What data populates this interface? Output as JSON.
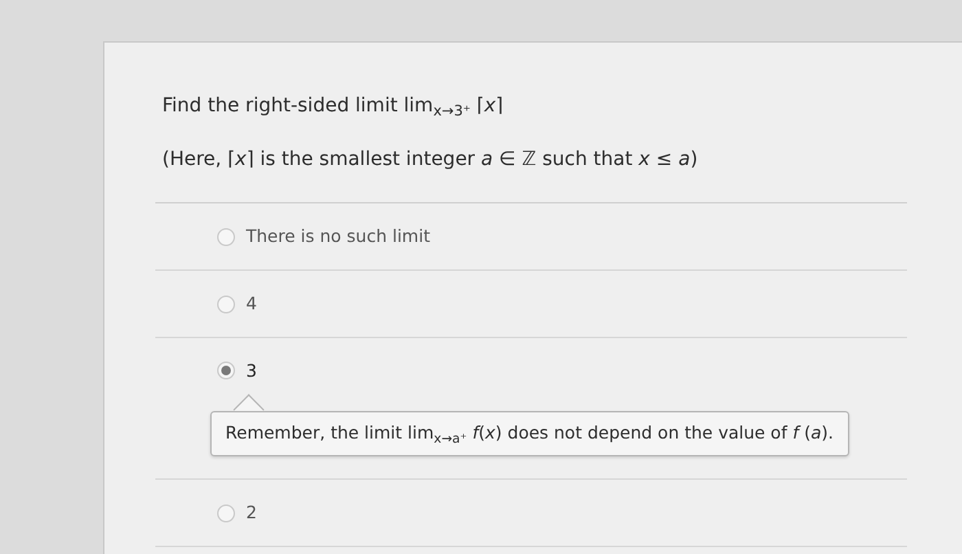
{
  "question": {
    "prompt": "Find the right-sided limit lim$_{x→3⁺}$ ⌈*x*⌉",
    "note": "(Here, ⌈*x*⌉ is the smallest integer *a* ∈ ℤ such that *x* ≤ *a*)"
  },
  "options": [
    {
      "label": "There is no such limit",
      "selected": false
    },
    {
      "label": "4",
      "selected": false
    },
    {
      "label": "3",
      "selected": true,
      "feedback": "Remember, the limit lim$_{x→a⁺}$ *f*(*x*) does not depend on the value of *f* (*a*)."
    },
    {
      "label": "2",
      "selected": false
    }
  ]
}
